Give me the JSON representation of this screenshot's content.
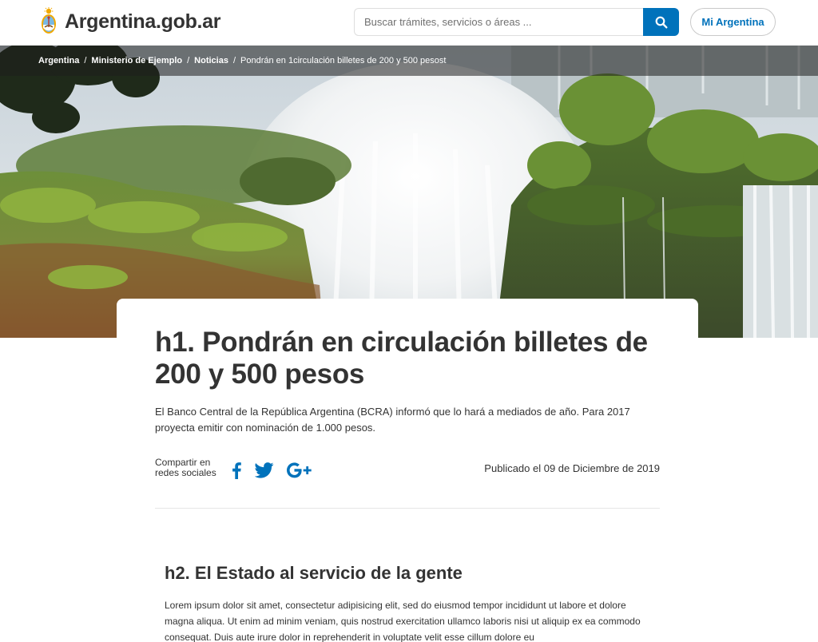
{
  "header": {
    "logo_text": "Argentina.gob.ar",
    "search_placeholder": "Buscar trámites, servicios o áreas ...",
    "mi_argentina_label": "Mi Argentina",
    "accent_color": "#0072bb"
  },
  "breadcrumb": {
    "items": [
      "Argentina",
      "Ministerio de Ejemplo",
      "Noticias"
    ],
    "current": "Pondrán en 1circulación billetes de 200 y 500 pesost",
    "separator": "/"
  },
  "article": {
    "title": "h1. Pondrán en circulación billetes de 200 y 500 pesos",
    "lead": "El Banco Central de la República Argentina (BCRA) informó que lo hará a mediados de año. Para 2017 proyecta emitir con nominación de 1.000 pesos.",
    "share_label": "Compartir en redes sociales",
    "share_icons": [
      "facebook-icon",
      "twitter-icon",
      "google-plus-icon"
    ],
    "published": "Publicado el 09 de Diciembre de 2019",
    "section_title": "h2. El Estado al servicio de la gente",
    "section_body": "Lorem ipsum dolor sit amet, consectetur adipisicing elit, sed do eiusmod tempor incididunt ut labore et dolore magna aliqua. Ut enim ad minim veniam, quis nostrud exercitation ullamco laboris nisi ut aliquip ex ea commodo consequat. Duis aute irure dolor in reprehenderit in voluptate velit esse cillum dolore eu"
  }
}
